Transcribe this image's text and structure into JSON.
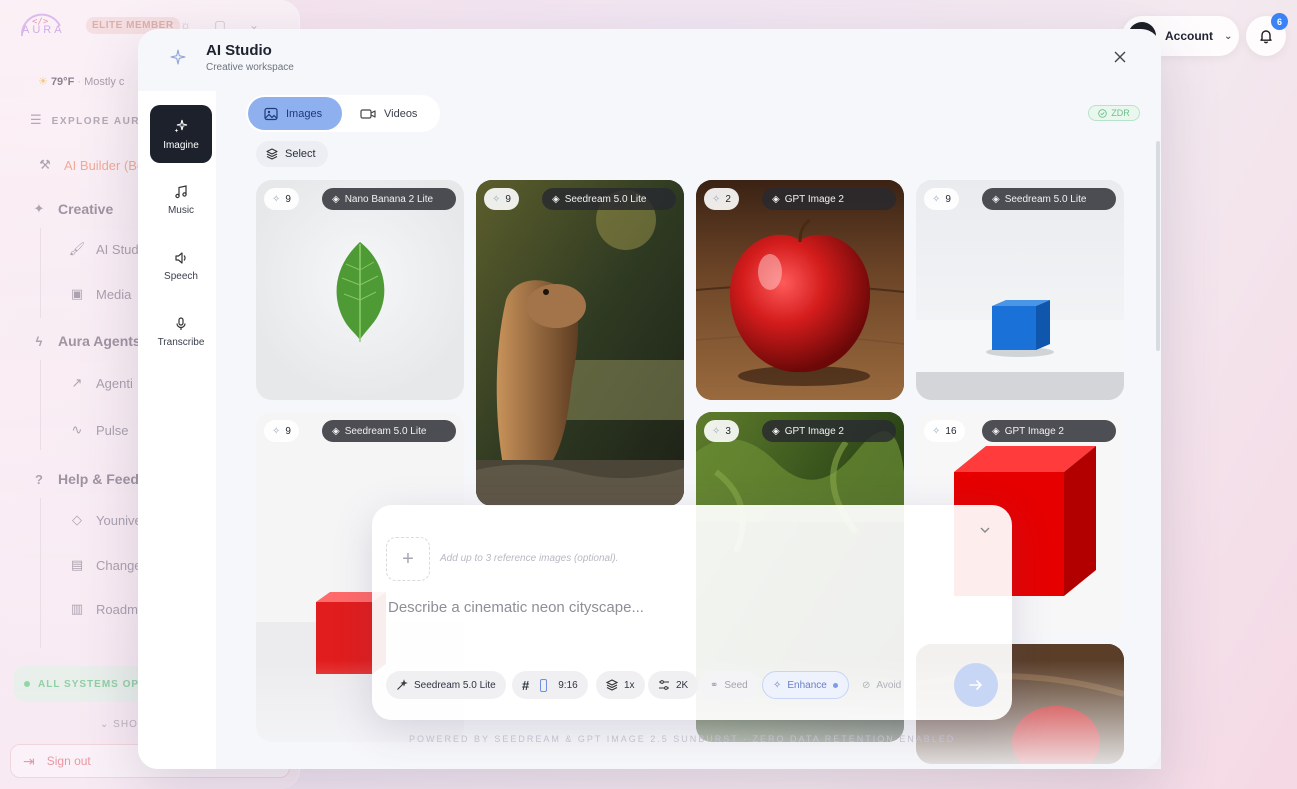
{
  "background_sidebar": {
    "logo_text": "AURA",
    "badge": "ELITE MEMBER",
    "weather": {
      "temp": "79°F",
      "desc": "Mostly c"
    },
    "explore_label": "EXPLORE AURA",
    "items": [
      {
        "label": "AI Builder (Be",
        "icon": "hammer-icon"
      },
      {
        "label": "Creative",
        "icon": "wand-icon"
      },
      {
        "label": "AI Stud",
        "icon": "brush-icon"
      },
      {
        "label": "Media",
        "icon": "image-icon"
      },
      {
        "label": "Aura Agents",
        "icon": "bolt-icon"
      },
      {
        "label": "Agenti",
        "icon": "trend-icon"
      },
      {
        "label": "Pulse",
        "icon": "pulse-icon"
      },
      {
        "label": "Help & Feedb",
        "icon": "help-icon"
      },
      {
        "label": "Younive",
        "icon": "graduation-icon"
      },
      {
        "label": "Change",
        "icon": "newspaper-icon"
      },
      {
        "label": "Roadm",
        "icon": "map-icon"
      }
    ],
    "status": "ALL SYSTEMS OPE",
    "show_label": "SHO",
    "sign_out": "Sign out"
  },
  "topbar": {
    "account_label": "Account",
    "notification_count": "6"
  },
  "modal": {
    "title": "AI Studio",
    "subtitle": "Creative workspace",
    "modes": [
      {
        "label": "Imagine",
        "icon": "sparkles-icon",
        "active": true
      },
      {
        "label": "Music",
        "icon": "music-note-icon",
        "active": false
      },
      {
        "label": "Speech",
        "icon": "speaker-icon",
        "active": false
      },
      {
        "label": "Transcribe",
        "icon": "microphone-icon",
        "active": false
      }
    ],
    "tabs": [
      {
        "label": "Images",
        "icon": "image-icon",
        "active": true
      },
      {
        "label": "Videos",
        "icon": "video-icon",
        "active": false
      }
    ],
    "zdr_label": "ZDR",
    "select_label": "Select",
    "cards": [
      {
        "count": "9",
        "model": "Nano Banana 2 Lite",
        "subject": "leaf"
      },
      {
        "count": "9",
        "model": "Seedream 5.0 Lite",
        "subject": "capybara"
      },
      {
        "count": "2",
        "model": "GPT Image 2",
        "subject": "apple"
      },
      {
        "count": "9",
        "model": "Seedream 5.0 Lite",
        "subject": "blue-cube"
      },
      {
        "count": "9",
        "model": "Seedream 5.0 Lite",
        "subject": "red-cube-small"
      },
      {
        "count": "3",
        "model": "GPT Image 2",
        "subject": "jungle"
      },
      {
        "count": "16",
        "model": "GPT Image 2",
        "subject": "red-cube-large"
      }
    ],
    "composer": {
      "ref_hint": "Add up to 3 reference images (optional).",
      "placeholder": "Describe a cinematic neon cityscape...",
      "chips": {
        "model": "Seedream 5.0 Lite",
        "aspect": "9:16",
        "count": "1x",
        "resolution": "2K",
        "seed": "Seed",
        "enhance": "Enhance",
        "avoid": "Avoid"
      }
    },
    "footer": "POWERED BY SEEDREAM & GPT IMAGE 2.5 SUNBURST · ZERO DATA RETENTION ENABLED"
  }
}
